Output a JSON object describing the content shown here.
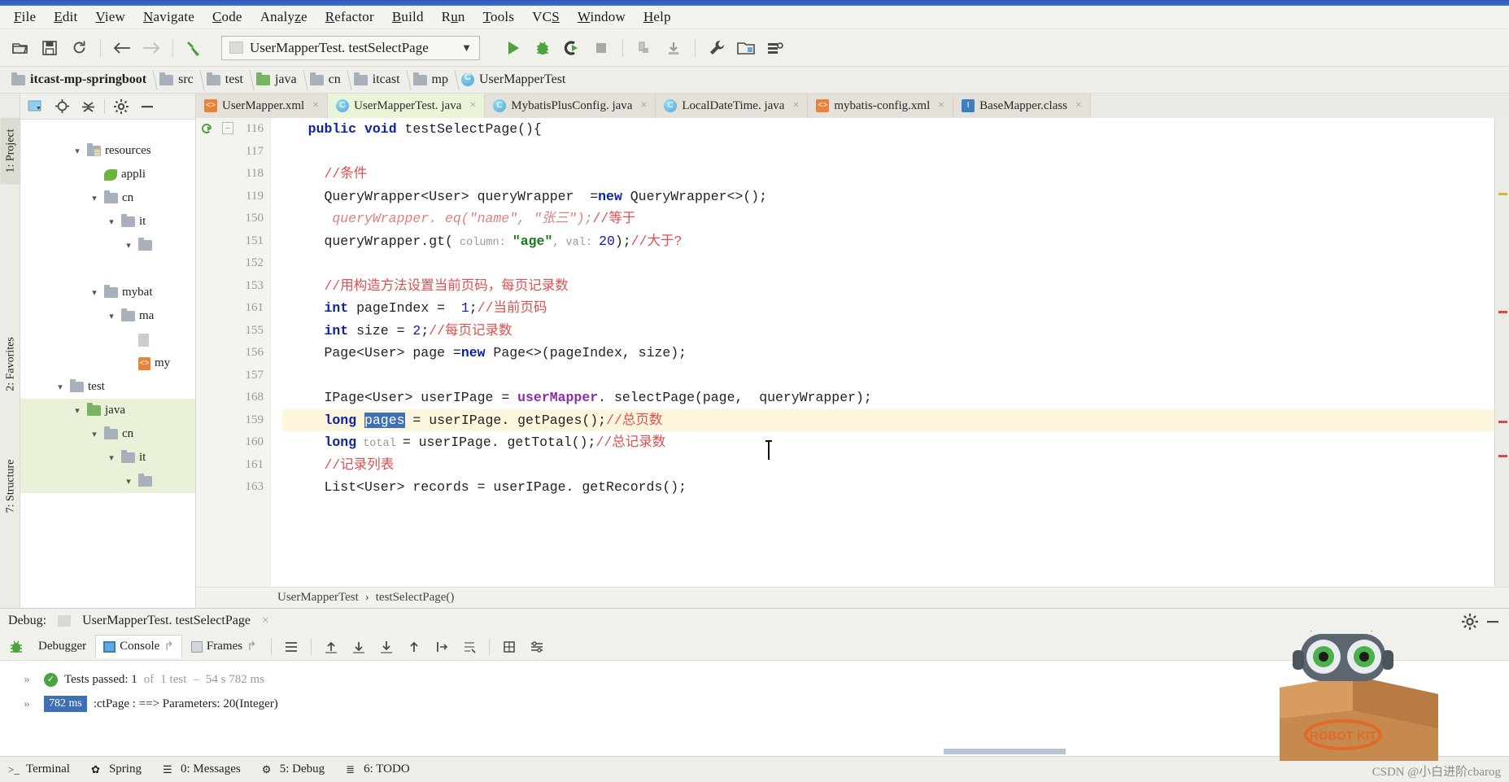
{
  "menu": {
    "items": [
      {
        "label": "File",
        "mn": "F"
      },
      {
        "label": "Edit",
        "mn": "E"
      },
      {
        "label": "View",
        "mn": "V"
      },
      {
        "label": "Navigate",
        "mn": "N"
      },
      {
        "label": "Code",
        "mn": "C"
      },
      {
        "label": "Analyze",
        "mn": "z"
      },
      {
        "label": "Refactor",
        "mn": "R"
      },
      {
        "label": "Build",
        "mn": "B"
      },
      {
        "label": "Run",
        "mn": "u"
      },
      {
        "label": "Tools",
        "mn": "T"
      },
      {
        "label": "VCS",
        "mn": "S"
      },
      {
        "label": "Window",
        "mn": "W"
      },
      {
        "label": "Help",
        "mn": "H"
      }
    ]
  },
  "toolbar": {
    "open_label": "open-project",
    "save_label": "save-all",
    "sync_label": "sync",
    "back_label": "back",
    "forward_label": "forward",
    "build_label": "build",
    "run_config": "UserMapperTest. testSelectPage",
    "run_label": "Run",
    "debug_label": "Debug",
    "coverage_label": "Run with Coverage",
    "stop_label": "Stop",
    "profile_label": "Profile",
    "attach_label": "Attach",
    "settings_label": "Settings",
    "project_structure_label": "Project Structure",
    "search_label": "Search Everywhere"
  },
  "breadcrumb": {
    "items": [
      {
        "label": "itcast-mp-springboot",
        "icon": "folder",
        "bold": true
      },
      {
        "label": "src",
        "icon": "folder"
      },
      {
        "label": "test",
        "icon": "folder"
      },
      {
        "label": "java",
        "icon": "folder-green"
      },
      {
        "label": "cn",
        "icon": "folder"
      },
      {
        "label": "itcast",
        "icon": "folder"
      },
      {
        "label": "mp",
        "icon": "folder"
      },
      {
        "label": "UserMapperTest",
        "icon": "class"
      }
    ]
  },
  "left_tool_strips": {
    "project": "1: Project",
    "structure": "7: Structure",
    "favorites": "2: Favorites"
  },
  "project_tree": {
    "items": [
      {
        "label": "resources",
        "indent": 3,
        "chev": "v",
        "icon": "folder-res",
        "sel": false
      },
      {
        "label": "appli",
        "indent": 4,
        "chev": "",
        "icon": "spring",
        "sel": false
      },
      {
        "label": "cn",
        "indent": 4,
        "chev": "v",
        "icon": "folder",
        "sel": false
      },
      {
        "label": "it",
        "indent": 5,
        "chev": "v",
        "icon": "folder",
        "sel": false
      },
      {
        "label": "",
        "indent": 6,
        "chev": "v",
        "icon": "folder",
        "sel": false
      },
      {
        "label": "",
        "indent": 6,
        "chev": "",
        "icon": "",
        "sel": false
      },
      {
        "label": "mybat",
        "indent": 4,
        "chev": "v",
        "icon": "folder",
        "sel": false
      },
      {
        "label": "ma",
        "indent": 5,
        "chev": "v",
        "icon": "folder",
        "sel": false
      },
      {
        "label": "",
        "indent": 6,
        "chev": "",
        "icon": "doc",
        "sel": false
      },
      {
        "label": "my",
        "indent": 6,
        "chev": "",
        "icon": "xml",
        "sel": false
      },
      {
        "label": "test",
        "indent": 2,
        "chev": "v",
        "icon": "folder",
        "sel": false
      },
      {
        "label": "java",
        "indent": 3,
        "chev": "v",
        "icon": "folder-green",
        "sel": true
      },
      {
        "label": "cn",
        "indent": 4,
        "chev": "v",
        "icon": "folder",
        "sel": true
      },
      {
        "label": "it",
        "indent": 5,
        "chev": "v",
        "icon": "folder",
        "sel": true
      },
      {
        "label": "",
        "indent": 6,
        "chev": "v",
        "icon": "folder",
        "sel": true
      }
    ]
  },
  "editor_tabs": {
    "items": [
      {
        "label": "UserMapper.xml",
        "icon": "xml",
        "active": false,
        "close": "×"
      },
      {
        "label": "UserMapperTest. java",
        "icon": "java",
        "active": true,
        "close": "×"
      },
      {
        "label": "MybatisPlusConfig. java",
        "icon": "java",
        "active": false,
        "close": "×"
      },
      {
        "label": "LocalDateTime. java",
        "icon": "java",
        "active": false,
        "close": "×"
      },
      {
        "label": "mybatis-config.xml",
        "icon": "xml",
        "active": false,
        "close": "×"
      },
      {
        "label": "BaseMapper.class",
        "icon": "iface",
        "active": false,
        "close": "×"
      }
    ]
  },
  "code": {
    "line_numbers": [
      "116",
      "117",
      "118",
      "119",
      "150",
      "151",
      "152",
      "153",
      "161",
      "155",
      "156",
      "157",
      "168",
      "159",
      "160",
      "161",
      "163"
    ],
    "gutter_run_icon": "run-test-icon",
    "fold_icon": "fold-icon",
    "left_comment_marker": "//",
    "lines": {
      "l1_pub": "public ",
      "l1_void": "void ",
      "l1_rest": "testSelectPage(){",
      "l3_cmt": "//条件",
      "l4_a": "QueryWrapper<User> queryWrapper  =",
      "l4_new": "new",
      "l4_b": " QueryWrapper<>();",
      "l5_cmt": "queryWrapper. eq(\"name\", \"张三\");",
      "l5_cmt2": "//等于",
      "l6_a": "queryWrapper.gt(",
      "l6_hint1": " column: ",
      "l6_str": "\"age\"",
      "l6_hint2": ", val: ",
      "l6_num": "20",
      "l6_b": ");",
      "l6_cmt": "//大于?",
      "l8_cmt": "//用构造方法设置当前页码，每页记录数",
      "l9_kw": "int",
      "l9_a": " pageIndex =  ",
      "l9_num": "1",
      "l9_semi": ";",
      "l9_cmt": "//当前页码",
      "l10_kw": "int",
      "l10_a": " size = ",
      "l10_num": "2",
      "l10_semi": ";",
      "l10_cmt": "//每页记录数",
      "l11_a": "Page<User> page =",
      "l11_new": "new",
      "l11_b": " Page<>(pageIndex, size);",
      "l13_a": "IPage<User> userIPage = ",
      "l13_field": "userMapper",
      "l13_b": ". selectPage(page,  queryWrapper);",
      "l14_kw": "long",
      "l14_sel": "pages",
      "l14_a": " = userIPage. getPages();",
      "l14_cmt": "//总页数",
      "l15_kw": "long",
      "l15_var": " total ",
      "l15_a": "= userIPage. getTotal();",
      "l15_cmt": "//总记录数",
      "l16_cmt": "//记录列表",
      "l17_a": "List<User> records = userIPage. getRecords();"
    },
    "crumb": {
      "cls": "UserMapperTest",
      "sep": "›",
      "method": "testSelectPage()"
    }
  },
  "debug": {
    "title_label": "Debug:",
    "session": "UserMapperTest. testSelectPage",
    "close": "×",
    "tabs": [
      {
        "label": "Debugger",
        "icon": "bug-icon",
        "active": false
      },
      {
        "label": "Console",
        "icon": "console-icon",
        "active": true,
        "pin": "↱"
      },
      {
        "label": "Frames",
        "icon": "frames-icon",
        "active": false,
        "pin": "↱"
      }
    ],
    "buttons": [
      {
        "name": "show-all-icon",
        "glyph": "≡"
      },
      {
        "name": "step-out-icon",
        "glyph": "⤴"
      },
      {
        "name": "step-over-icon",
        "glyph": "⤓"
      },
      {
        "name": "step-into-icon",
        "glyph": "⤓"
      },
      {
        "name": "force-step-icon",
        "glyph": "⤒"
      },
      {
        "name": "run-to-cursor-icon",
        "glyph": "⤨"
      },
      {
        "name": "evaluate-icon",
        "glyph": "⤷"
      },
      {
        "name": "mute-breakpoints-icon",
        "glyph": "▦"
      },
      {
        "name": "settings-icon",
        "glyph": "☲"
      }
    ],
    "console": {
      "rows": [
        {
          "chev": "»",
          "status_icon": "check-icon",
          "text": "Tests passed: 1",
          "dim1": "of",
          "dim2": "1 test",
          "dash": "–",
          "time": "54 s 782 ms"
        },
        {
          "chev": "»",
          "badge": "782 ms",
          "text": ":ctPage     : ==> Parameters: 20(Integer)"
        }
      ]
    },
    "gear_label": "settings-gear"
  },
  "statusbar": {
    "items": [
      {
        "label": "Terminal",
        "icon": "terminal-icon"
      },
      {
        "label": "Spring",
        "icon": "spring-icon"
      },
      {
        "label": "0: Messages",
        "icon": "messages-icon"
      },
      {
        "label": "5: Debug",
        "icon": "debug-icon"
      },
      {
        "label": "6: TODO",
        "icon": "todo-icon"
      }
    ]
  },
  "watermark": "CSDN @小白进阶cbarog",
  "colors": {
    "accent": "#3f6fb5",
    "run_green": "#4aa33e",
    "comment_red": "#e0504f",
    "keyword_blue": "#0d22a8",
    "string_green": "#1a7a1a",
    "field_purple": "#8b2fa8",
    "selection_bg": "#3f6fb5",
    "highlight_line": "#fdf6dd"
  }
}
